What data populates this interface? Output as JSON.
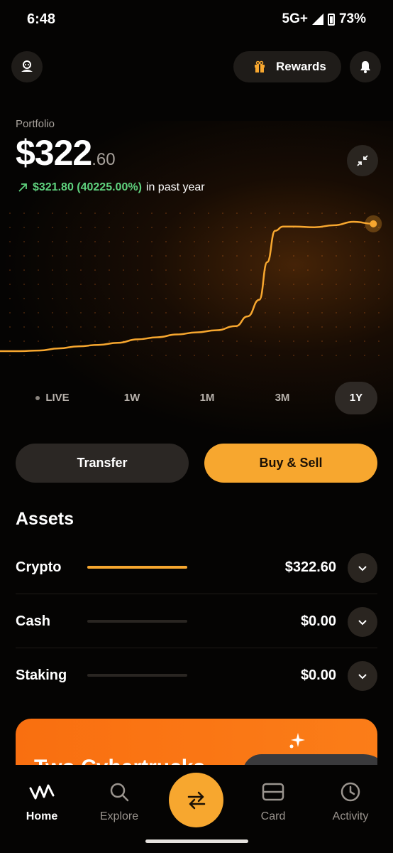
{
  "status_bar": {
    "time": "6:48",
    "network": "5G+",
    "battery": "73%"
  },
  "header": {
    "profile_icon": "profile-icon",
    "rewards_label": "Rewards",
    "rewards_icon": "gift-icon",
    "notifications_icon": "bell-icon"
  },
  "portfolio": {
    "label": "Portfolio",
    "value_whole": "$322",
    "value_cents": ".60",
    "change_amount": "$321.80 (40225.00%)",
    "change_suffix": "in past year",
    "change_color": "#5fd27e",
    "accent_color": "#f7a72f",
    "collapse_icon": "collapse-icon"
  },
  "chart_data": {
    "type": "line",
    "x": [
      0,
      0.05,
      0.1,
      0.15,
      0.2,
      0.25,
      0.3,
      0.35,
      0.4,
      0.45,
      0.5,
      0.55,
      0.6,
      0.63,
      0.66,
      0.68,
      0.7,
      0.72,
      0.75,
      0.8,
      0.85,
      0.9,
      0.95
    ],
    "values": [
      2,
      2,
      3,
      6,
      9,
      11,
      14,
      19,
      22,
      26,
      29,
      32,
      38,
      52,
      76,
      130,
      175,
      181,
      181,
      180,
      183,
      188,
      185
    ],
    "xlabel": "",
    "ylabel": "",
    "grid": true
  },
  "ranges": {
    "items": [
      "LIVE",
      "1W",
      "1M",
      "3M",
      "1Y"
    ],
    "active": "1Y"
  },
  "actions": {
    "transfer": "Transfer",
    "buy_sell": "Buy & Sell"
  },
  "assets": {
    "title": "Assets",
    "rows": [
      {
        "name": "Crypto",
        "value": "$322.60",
        "share": 1.0
      },
      {
        "name": "Cash",
        "value": "$0.00",
        "share": 0
      },
      {
        "name": "Staking",
        "value": "$0.00",
        "share": 0
      }
    ]
  },
  "promo": {
    "text": "Two Cybertrucks"
  },
  "nav": {
    "home": "Home",
    "explore": "Explore",
    "card": "Card",
    "activity": "Activity",
    "fab_icon": "swap-arrows-icon"
  }
}
